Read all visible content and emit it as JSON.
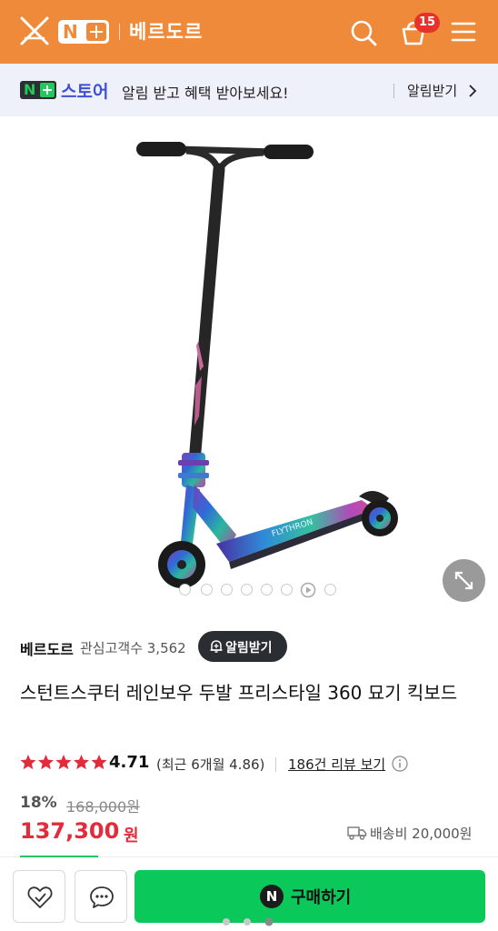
{
  "header": {
    "logo_badge": "N+",
    "title": "베르도르",
    "cart_count": "15",
    "bg_color": "#ef8a3a"
  },
  "notice": {
    "badge": "N+",
    "store": "스토어",
    "text": "알림 받고 혜택 받아보세요!",
    "link": "알림받기"
  },
  "gallery": {
    "slide_count": 8,
    "current_slide": 1,
    "video_slide": 7
  },
  "seller": {
    "name": "베르도르",
    "fans_label": "관심고객수 3,562",
    "alarm_button": "알림받기"
  },
  "product": {
    "title": "스턴트스쿠터 레인보우 두발 프리스타일 360 묘기 킥보드"
  },
  "rating": {
    "stars": 4.71,
    "value": "4.71",
    "recent": "(최근 6개월 4.86)",
    "reviews_link": "186건 리뷰 보기",
    "star_color": "#e12c3c"
  },
  "price": {
    "discount": "18%",
    "original": "168,000원",
    "sale": "137,300",
    "unit": "원",
    "shipping": "배송비 20,000원",
    "sale_color": "#e12c3c"
  },
  "bottom": {
    "like_icon": "heart-icon",
    "talk_icon": "chat-icon",
    "buy_badge": "N",
    "buy_label": "구매하기",
    "buy_color": "#0ac85a"
  }
}
